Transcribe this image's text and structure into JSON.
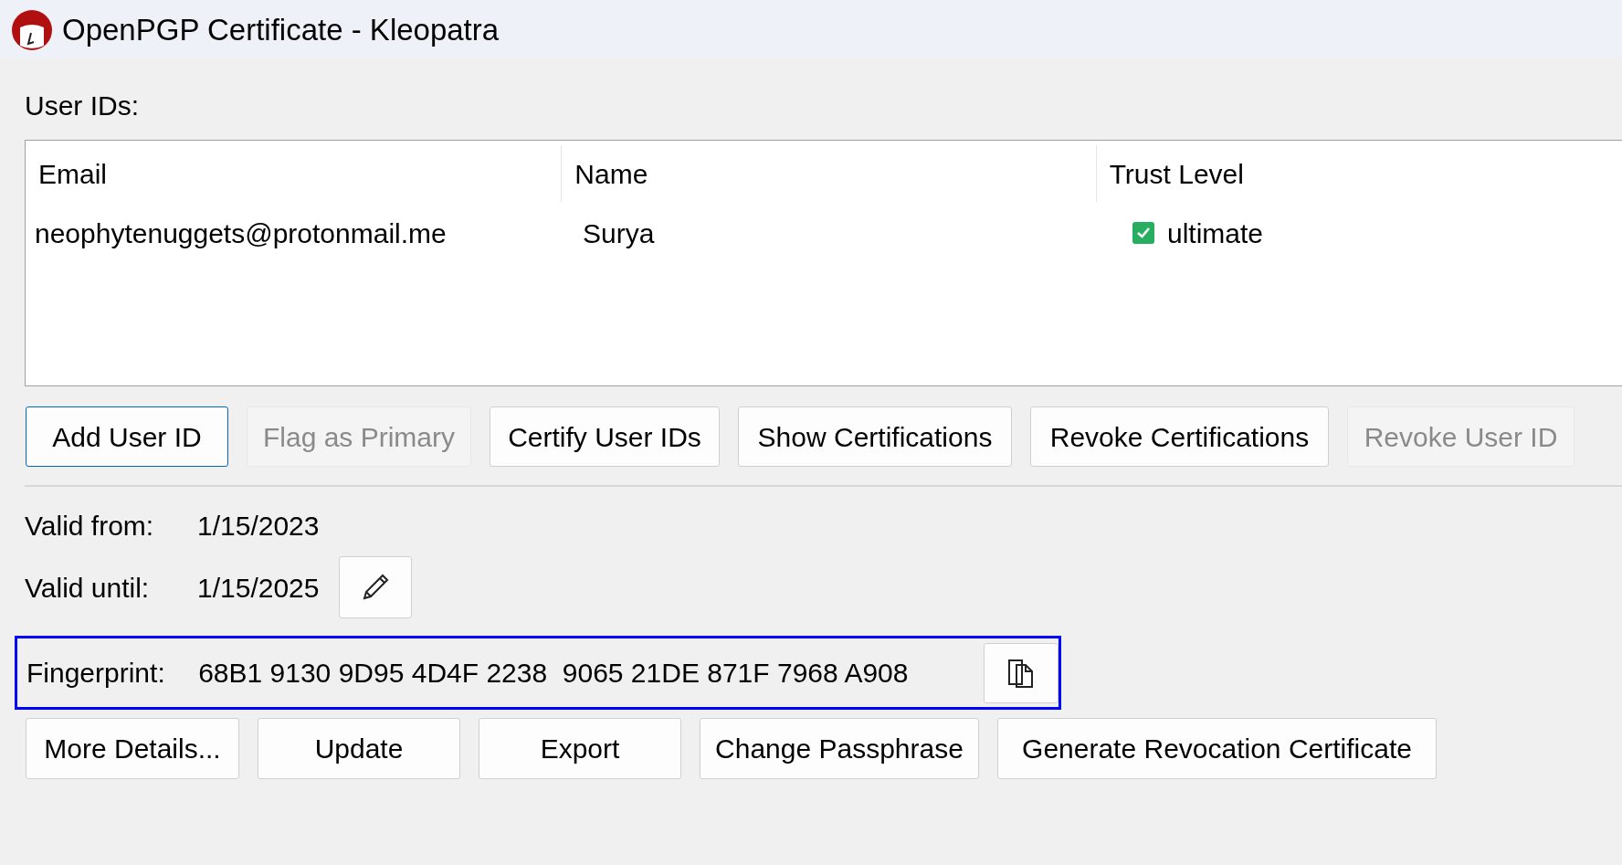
{
  "window": {
    "title": "OpenPGP Certificate - Kleopatra"
  },
  "user_ids": {
    "label": "User IDs:",
    "columns": [
      "Email",
      "Name",
      "Trust Level"
    ],
    "rows": [
      {
        "email": "neophytenuggets@protonmail.me",
        "name": "Surya",
        "trust": "ultimate",
        "checked": true
      }
    ]
  },
  "user_id_buttons": [
    {
      "label": "Add User ID",
      "disabled": false,
      "focused": true
    },
    {
      "label": "Flag as Primary",
      "disabled": true,
      "focused": false
    },
    {
      "label": "Certify User IDs",
      "disabled": false,
      "focused": false
    },
    {
      "label": "Show Certifications",
      "disabled": false,
      "focused": false
    },
    {
      "label": "Revoke Certifications",
      "disabled": false,
      "focused": false
    },
    {
      "label": "Revoke User ID",
      "disabled": true,
      "focused": false
    }
  ],
  "validity": [
    {
      "label": "Valid from:",
      "value": "1/15/2023",
      "editable": false
    },
    {
      "label": "Valid until:",
      "value": "1/15/2025",
      "editable": true
    }
  ],
  "fingerprint": {
    "label": "Fingerprint:",
    "value": "68B1 9130 9D95 4D4F 2238  9065 21DE 871F 7968 A908",
    "highlighted": true
  },
  "actions": [
    "More Details...",
    "Update",
    "Export",
    "Change Passphrase",
    "Generate Revocation Certificate"
  ]
}
